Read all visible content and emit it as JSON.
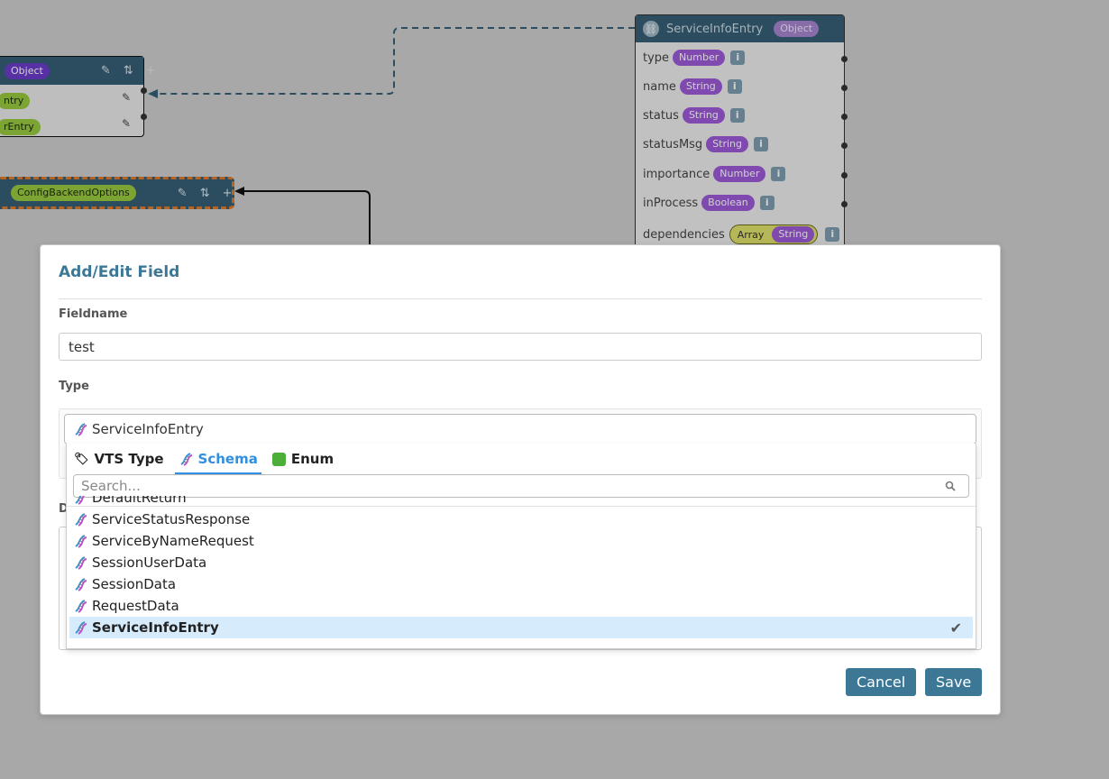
{
  "background_nodes": {
    "object_node": {
      "header_badge": "Object",
      "row1_badge": "ntry",
      "row2_badge": "rEntry"
    },
    "config_node": {
      "badge": "ConfigBackendOptions"
    },
    "service_info_node": {
      "title": "ServiceInfoEntry",
      "badge": "Object",
      "fields": [
        {
          "name": "type",
          "type": "Number"
        },
        {
          "name": "name",
          "type": "String"
        },
        {
          "name": "status",
          "type": "String"
        },
        {
          "name": "statusMsg",
          "type": "String"
        },
        {
          "name": "importance",
          "type": "Number"
        },
        {
          "name": "inProcess",
          "type": "Boolean"
        }
      ],
      "dependencies": {
        "name": "dependencies",
        "type_outer": "Array",
        "type_inner": "String"
      }
    }
  },
  "modal": {
    "title": "Add/Edit Field",
    "fieldname_label": "Fieldname",
    "fieldname_value": "test",
    "type_label": "Type",
    "description_label": "D",
    "cancel_label": "Cancel",
    "save_label": "Save"
  },
  "type_select": {
    "selected_value": "ServiceInfoEntry",
    "tabs": [
      {
        "label": "VTS Type",
        "icon": "tag-icon",
        "active": false
      },
      {
        "label": "Schema",
        "icon": "dna-icon",
        "active": true
      },
      {
        "label": "Enum",
        "icon": "puzzle-icon",
        "active": false
      }
    ],
    "search_placeholder": "Search...",
    "options": [
      {
        "label": "DefaultReturn",
        "selected": false
      },
      {
        "label": "ServiceStatusResponse",
        "selected": false
      },
      {
        "label": "ServiceByNameRequest",
        "selected": false
      },
      {
        "label": "SessionUserData",
        "selected": false
      },
      {
        "label": "SessionData",
        "selected": false
      },
      {
        "label": "RequestData",
        "selected": false
      },
      {
        "label": "ServiceInfoEntry",
        "selected": true
      }
    ],
    "check_glyph": "✔"
  },
  "colors": {
    "accent": "#3c7896",
    "tab_active": "#2f8fe0",
    "selected_row": "#d6ebfb"
  }
}
